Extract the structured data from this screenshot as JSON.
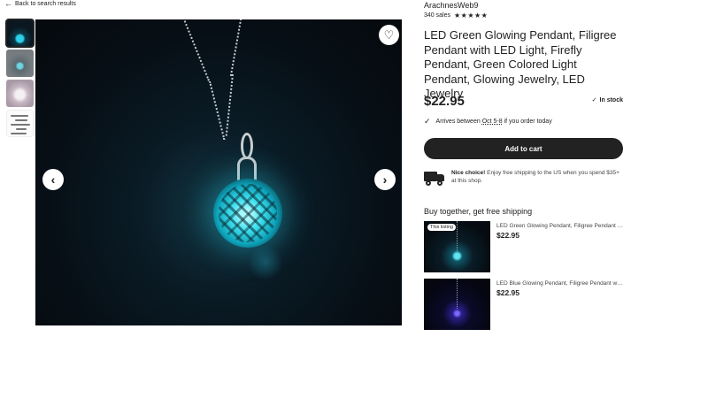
{
  "back_link": {
    "label": "Back to search results",
    "icon": "arrow-left-icon"
  },
  "gallery": {
    "thumbnails": [
      {
        "name": "thumbnail-1",
        "active": true
      },
      {
        "name": "thumbnail-2",
        "active": false
      },
      {
        "name": "thumbnail-3",
        "active": false
      },
      {
        "name": "thumbnail-4",
        "active": false
      }
    ],
    "favorite_icon": "heart-icon",
    "prev_icon": "chevron-left-icon",
    "next_icon": "chevron-right-icon"
  },
  "product": {
    "shop_name": "ArachnesWeb9",
    "sales": "340 sales",
    "stars": "★★★★★",
    "title": "LED Green Glowing Pendant, Filigree Pendant with LED Light, Firefly Pendant, Green Colored Light Pendant, Glowing Jewelry, LED Jewelry",
    "price": "$22.95",
    "stock": "In stock",
    "arrives_prefix": "Arrives between",
    "arrives_date": "Oct 5-8",
    "arrives_suffix": "if you order today",
    "add_to_cart": "Add to cart",
    "shipping_bold": "Nice choice!",
    "shipping_text": "Enjoy free shipping to the US when you spend $35+ at this shop."
  },
  "bundle": {
    "heading": "Buy together, get free shipping",
    "items": [
      {
        "badge": "This listing",
        "title": "LED Green Glowing Pendant, Filigree Pendant with LED Light",
        "price": "$22.95"
      },
      {
        "badge": "",
        "title": "LED Blue Glowing Pendant, Filigree Pendant with LED Light",
        "price": "$22.95"
      }
    ]
  },
  "colors": {
    "cart_button": "#222222",
    "accent_glow": "#2bd1e8"
  }
}
